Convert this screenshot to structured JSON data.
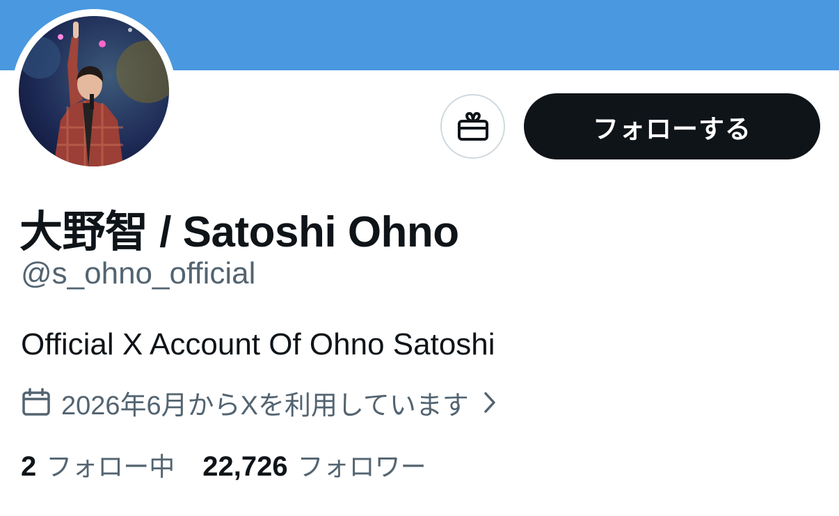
{
  "colors": {
    "banner": "#4a98e0",
    "follow_button_bg": "#0f1419",
    "secondary_text": "#536471",
    "primary_text": "#0f1419"
  },
  "profile": {
    "display_name": "大野智 / Satoshi Ohno",
    "handle": "@s_ohno_official",
    "bio": "Official X Account Of Ohno Satoshi",
    "joined": "2026年6月からXを利用しています"
  },
  "actions": {
    "gift_icon": "gift-icon",
    "follow_label": "フォローする"
  },
  "stats": {
    "following_count": "2",
    "following_label": "フォロー中",
    "followers_count": "22,726",
    "followers_label": "フォロワー"
  }
}
